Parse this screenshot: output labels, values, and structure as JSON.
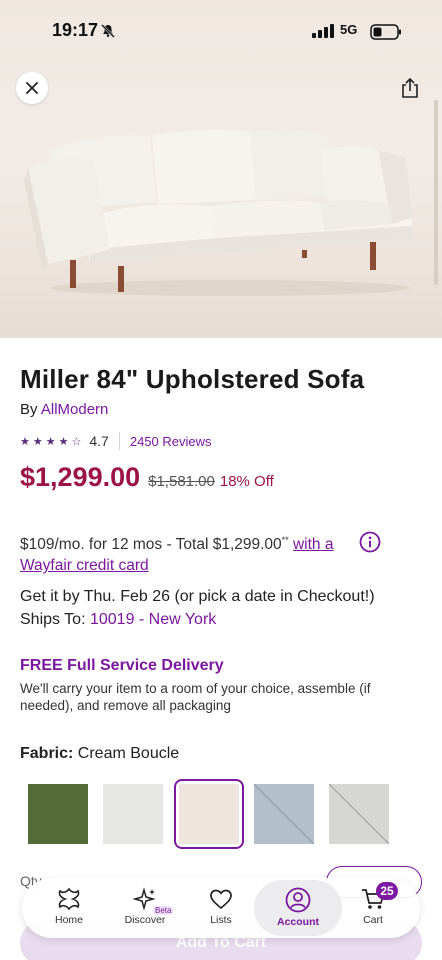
{
  "status_bar": {
    "time": "19:17",
    "network": "5G"
  },
  "product": {
    "title": "Miller 84\" Upholstered Sofa",
    "by_prefix": "By ",
    "brand": "AllModern",
    "rating": "4.7",
    "rating_stars": 4.5,
    "reviews": "2450 Reviews",
    "price": "$1,299.00",
    "original_price": "$1,581.00",
    "discount": "18% Off"
  },
  "financing": {
    "text": "$109/mo. for 12 mos - Total $1,299.00",
    "marker": "**",
    "link_text": "with a Wayfair credit card"
  },
  "delivery": {
    "eta": "Get it by Thu. Feb 26 (or pick a date in Checkout!)",
    "ships_to_label": "Ships To: ",
    "ships_to_value": "10019 - New York"
  },
  "service": {
    "title": "FREE Full Service Delivery",
    "description": "We'll carry your item to a room of your choice, assemble (if needed), and remove all packaging"
  },
  "fabric": {
    "label": "Fabric:",
    "selected": "Cream Boucle",
    "swatch_colors": [
      "#556b36",
      "#e7e7e5",
      "#eee6de",
      "#b3c0cb",
      "#d6d6d4"
    ]
  },
  "purchase": {
    "quantity_label": "Qty",
    "add_to_cart": "Add To Cart"
  },
  "nav": {
    "home": "Home",
    "discover": "Discover",
    "beta": "Beta",
    "lists": "Lists",
    "account": "Account",
    "cart": "Cart",
    "cart_count": "25"
  },
  "colors": {
    "accent": "#7b189f",
    "price": "#9c1446"
  }
}
